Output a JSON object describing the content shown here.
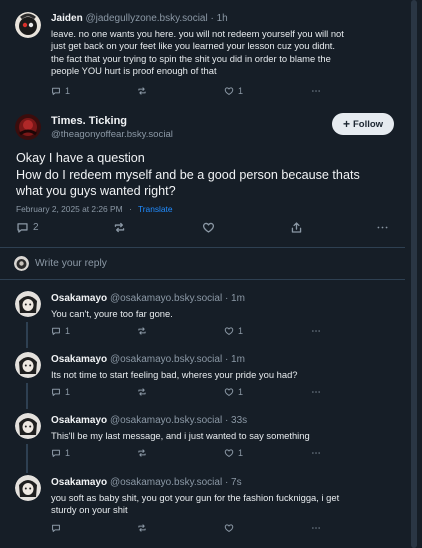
{
  "parent_post": {
    "author_name": "Jaiden",
    "handle": "@jadegullyzone.bsky.social",
    "time": "· 1h",
    "text_lines": [
      "leave. no one wants you here. you will not redeem yourself you will not",
      "just get back on your feet like you learned your lesson cuz you didnt.",
      "the fact that your trying to spin the shit you did in order to blame the",
      "people YOU hurt is proof enough of that"
    ],
    "reply_count": "1",
    "like_count": "1"
  },
  "main_post": {
    "author_name": "Times. Ticking",
    "handle": "@theagonyoffear.bsky.social",
    "follow_label": "Follow",
    "text_lines": [
      "Okay I have a question",
      "How do I redeem myself and be a good person because thats",
      "what you guys wanted right?"
    ],
    "date": "February 2, 2025 at 2:26 PM",
    "separator": "·",
    "translate_label": "Translate",
    "reply_count": "2"
  },
  "composer": {
    "placeholder": "Write your reply"
  },
  "replies": [
    {
      "author_name": "Osakamayo",
      "handle": "@osakamayo.bsky.social",
      "time": "· 1m",
      "text_lines": [
        "You can't, youre too far gone."
      ],
      "reply_count": "1",
      "like_count": "1"
    },
    {
      "author_name": "Osakamayo",
      "handle": "@osakamayo.bsky.social",
      "time": "· 1m",
      "text_lines": [
        "Its not time to start feeling bad, wheres your pride you had?"
      ],
      "reply_count": "1",
      "like_count": "1"
    },
    {
      "author_name": "Osakamayo",
      "handle": "@osakamayo.bsky.social",
      "time": "· 33s",
      "text_lines": [
        "This'll be my last message, and i just wanted to say something"
      ],
      "reply_count": "1",
      "like_count": "1"
    },
    {
      "author_name": "Osakamayo",
      "handle": "@osakamayo.bsky.social",
      "time": "· 7s",
      "text_lines": [
        "you soft as baby shit, you got your gun for the fashion fucknigga, i get",
        "sturdy on your shit"
      ],
      "reply_count": "",
      "like_count": ""
    }
  ],
  "icons": {
    "reply": "reply-icon",
    "repost": "repost-icon",
    "like": "heart-icon",
    "share": "share-icon",
    "more": "more-icon",
    "follow": "plus-icon"
  },
  "colors": {
    "background": "#161e27",
    "divider": "#2e4052",
    "secondary_text": "#8b98a5",
    "link": "#208bfe",
    "follow_button": "#e6ebf0"
  }
}
